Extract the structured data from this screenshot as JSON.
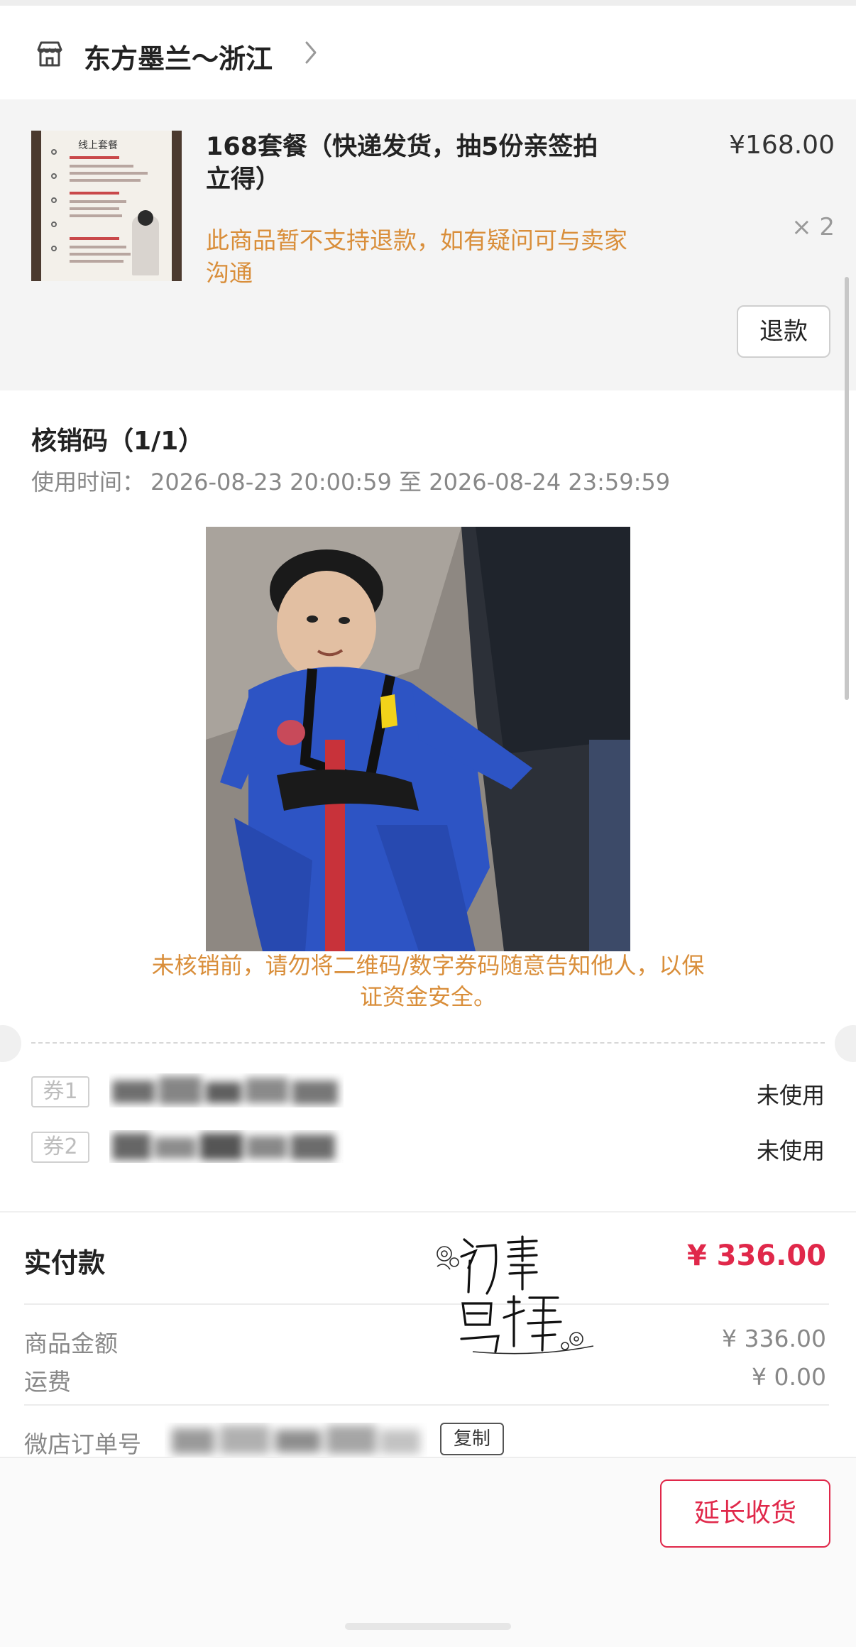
{
  "shop": {
    "name": "东方墨兰～浙江",
    "icon": "store-icon",
    "chevron_icon": "chevron-right-icon"
  },
  "product": {
    "title": "168套餐（快递发货，抽5份亲签拍立得）",
    "price": "¥168.00",
    "quantity": "× 2",
    "refund_notice": "此商品暂不支持退款，如有疑问可与卖家沟通",
    "refund_button": "退款",
    "thumbnail_title": "线上套餐"
  },
  "verification": {
    "title": "核销码（1/1）",
    "usage_time_label": "使用时间：",
    "usage_time_value": "2026-08-23 20:00:59 至 2026-08-24 23:59:59",
    "warning": "未核销前，请勿将二维码/数字券码随意告知他人，以保证资金安全。",
    "vouchers": [
      {
        "tag": "券1",
        "status": "未使用"
      },
      {
        "tag": "券2",
        "status": "未使用"
      }
    ]
  },
  "payment": {
    "paid_label": "实付款",
    "paid_amount": "¥ 336.00",
    "goods_label": "商品金额",
    "goods_amount": "¥ 336.00",
    "shipping_label": "运费",
    "shipping_amount": "¥ 0.00",
    "order_label": "微店订单号",
    "copy_button": "复制"
  },
  "watermark": {
    "text": "初霖岛椿"
  },
  "actions": {
    "extend_button": "延长收货"
  },
  "colors": {
    "accent_red": "#e0284a",
    "notice_orange": "#d98e3a"
  }
}
